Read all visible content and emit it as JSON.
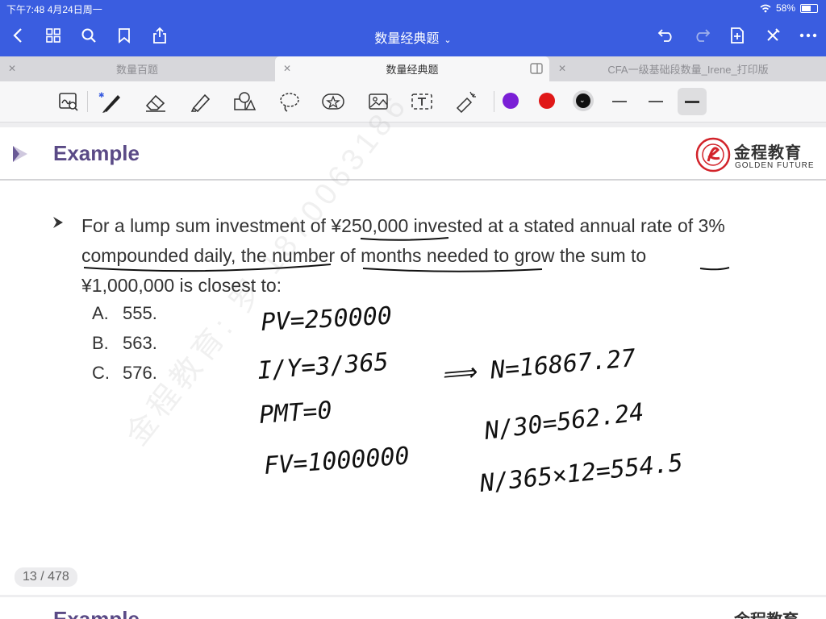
{
  "status": {
    "time": "下午7:48  4月24日周一",
    "battery": "58%"
  },
  "nav": {
    "title": "数量经典题"
  },
  "tabs": [
    {
      "label": "数量百题"
    },
    {
      "label": "数量经典题"
    },
    {
      "label": "CFA一级基础段数量_Irene_打印版"
    }
  ],
  "colors": {
    "purple": "#7a1fd6",
    "red": "#e01818",
    "black": "#111111",
    "accent": "#3a5de0"
  },
  "slide": {
    "title": "Example",
    "brand_cn": "金程教育",
    "brand_en": "GOLDEN FUTURE",
    "question": "For a lump sum investment of ¥250,000 invested at a stated annual rate of 3% compounded daily, the number of months needed to grow the sum to ¥1,000,000 is closest to:",
    "choices": [
      {
        "letter": "A.",
        "value": "555."
      },
      {
        "letter": "B.",
        "value": "563."
      },
      {
        "letter": "C.",
        "value": "576."
      }
    ],
    "watermark": "金程教育: 罗 1870063186"
  },
  "handwriting": {
    "pv": "PV=250000",
    "iy": "I/Y=3/365",
    "pmt": "PMT=0",
    "fv": "FV=1000000",
    "n": "⟹ N=16867.27",
    "n30": "N/30=562.24",
    "n365": "N/365×12=554.5"
  },
  "page_counter": "13 / 478",
  "next_slide": {
    "title": "Example",
    "brand_cn": "金程教育"
  }
}
